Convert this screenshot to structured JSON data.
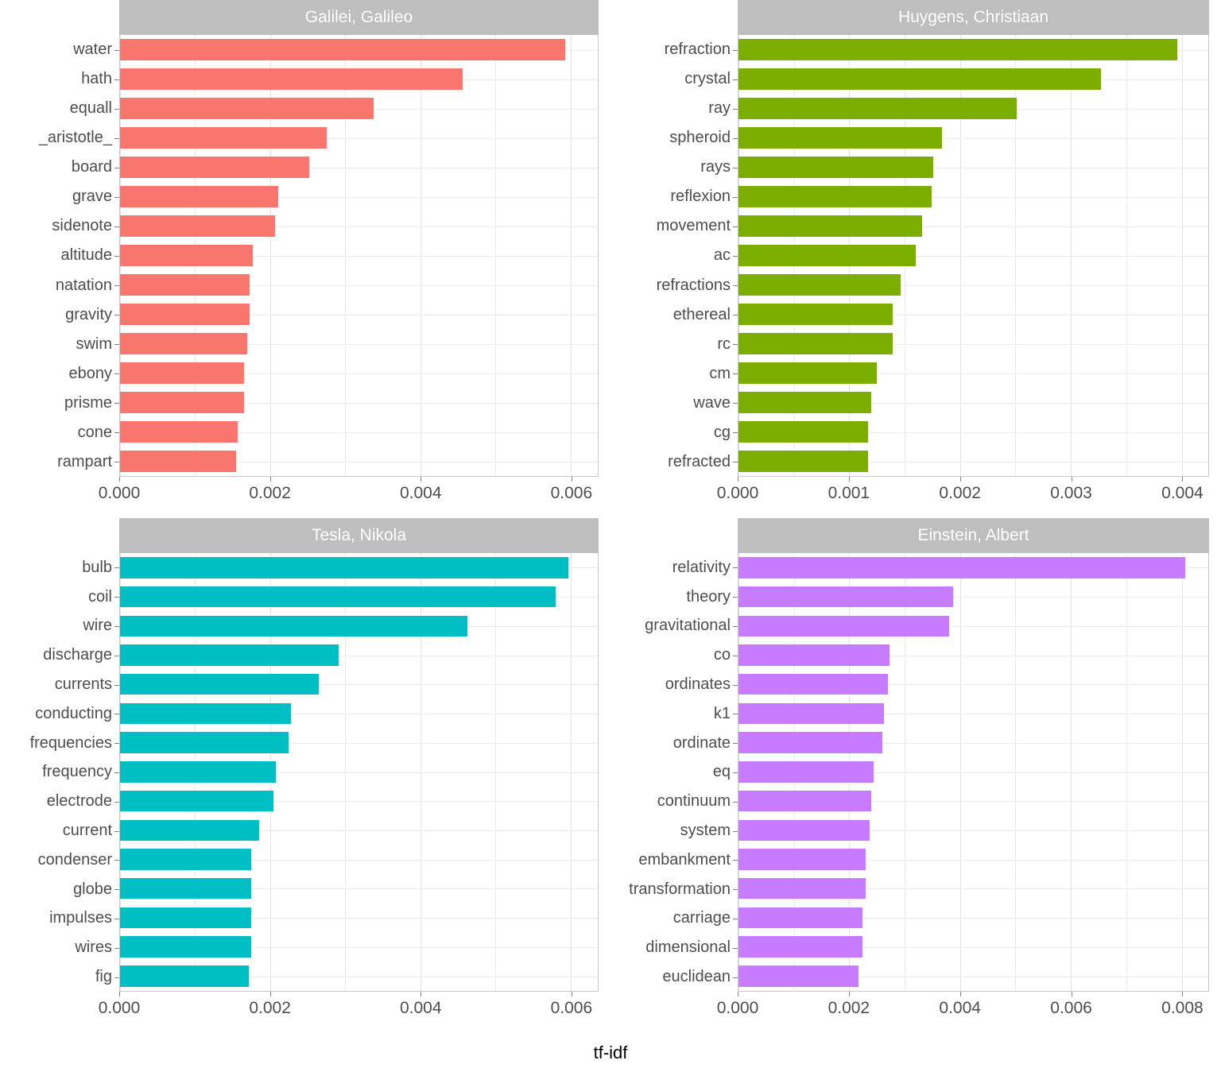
{
  "figure": {
    "xlabel": "tf-idf",
    "strip_bg": "#bebebe",
    "strip_fg": "#ffffff"
  },
  "chart_data": {
    "type": "bar",
    "title": "",
    "xlabel": "tf-idf",
    "ylabel": "",
    "orientation": "horizontal",
    "grid": true,
    "legend": "none",
    "facets": [
      {
        "title": "Galilei, Galileo",
        "color": "#f8766d",
        "xlim": [
          0,
          0.00636
        ],
        "xticks": [
          0.0,
          0.002,
          0.004,
          0.006
        ],
        "xticklabels": [
          "0.000",
          "0.002",
          "0.004",
          "0.006"
        ],
        "categories": [
          "water",
          "hath",
          "equall",
          "_aristotle_",
          "board",
          "grave",
          "sidenote",
          "altitude",
          "natation",
          "gravity",
          "swim",
          "ebony",
          "prisme",
          "cone",
          "rampart"
        ],
        "values": [
          0.00593,
          0.00456,
          0.00338,
          0.00275,
          0.00252,
          0.00211,
          0.00206,
          0.00177,
          0.00172,
          0.00172,
          0.00169,
          0.00165,
          0.00165,
          0.00157,
          0.00155
        ]
      },
      {
        "title": "Huygens, Christiaan",
        "color": "#7cae00",
        "xlim": [
          0,
          0.00424
        ],
        "xticks": [
          0.0,
          0.001,
          0.002,
          0.003,
          0.004
        ],
        "xticklabels": [
          "0.000",
          "0.001",
          "0.002",
          "0.003",
          "0.004"
        ],
        "categories": [
          "refraction",
          "crystal",
          "ray",
          "spheroid",
          "rays",
          "reflexion",
          "movement",
          "ac",
          "refractions",
          "ethereal",
          "rc",
          "cm",
          "wave",
          "cg",
          "refracted"
        ],
        "values": [
          0.00396,
          0.00327,
          0.00251,
          0.00184,
          0.00176,
          0.00174,
          0.00166,
          0.0016,
          0.00146,
          0.00139,
          0.00139,
          0.00125,
          0.0012,
          0.00117,
          0.00117
        ]
      },
      {
        "title": "Tesla, Nikola",
        "color": "#00bfc4",
        "xlim": [
          0,
          0.00636
        ],
        "xticks": [
          0.0,
          0.002,
          0.004,
          0.006
        ],
        "xticklabels": [
          "0.000",
          "0.002",
          "0.004",
          "0.006"
        ],
        "categories": [
          "bulb",
          "coil",
          "wire",
          "discharge",
          "currents",
          "conducting",
          "frequencies",
          "frequency",
          "electrode",
          "current",
          "condenser",
          "globe",
          "impulses",
          "wires",
          "fig"
        ],
        "values": [
          0.00597,
          0.0058,
          0.00462,
          0.00291,
          0.00265,
          0.00227,
          0.00224,
          0.00207,
          0.00204,
          0.00185,
          0.00175,
          0.00175,
          0.00175,
          0.00175,
          0.00171
        ]
      },
      {
        "title": "Einstein, Albert",
        "color": "#c77cff",
        "xlim": [
          0,
          0.00848
        ],
        "xticks": [
          0.0,
          0.002,
          0.004,
          0.006,
          0.008
        ],
        "xticklabels": [
          "0.000",
          "0.002",
          "0.004",
          "0.006",
          "0.008"
        ],
        "categories": [
          "relativity",
          "theory",
          "gravitational",
          "co",
          "ordinates",
          "k1",
          "ordinate",
          "eq",
          "continuum",
          "system",
          "embankment",
          "transformation",
          "carriage",
          "dimensional",
          "euclidean"
        ],
        "values": [
          0.00807,
          0.00388,
          0.0038,
          0.00272,
          0.0027,
          0.00262,
          0.0026,
          0.00244,
          0.0024,
          0.00237,
          0.0023,
          0.0023,
          0.00224,
          0.00224,
          0.00216
        ]
      }
    ]
  }
}
